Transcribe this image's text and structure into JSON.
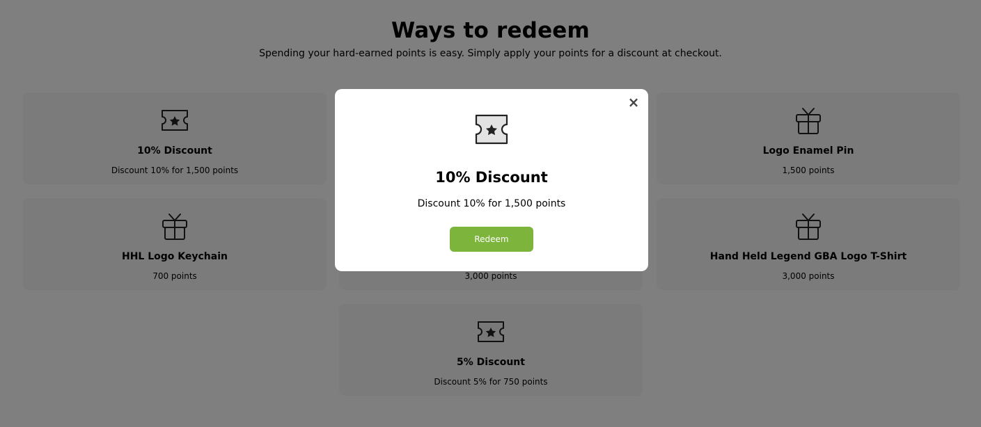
{
  "header": {
    "title": "Ways to redeem",
    "subtitle": "Spending your hard-earned points is easy. Simply apply your points for a discount at checkout."
  },
  "rewards": [
    {
      "title": "10% Discount",
      "desc": "Discount 10% for 1,500 points",
      "icon": "ticket-star-icon"
    },
    {
      "title": "",
      "desc": "",
      "icon": ""
    },
    {
      "title": "Logo Enamel Pin",
      "desc": "1,500 points",
      "icon": "gift-icon"
    },
    {
      "title": "HHL Logo Keychain",
      "desc": "700 points",
      "icon": "gift-icon"
    },
    {
      "title": "",
      "desc": "3,000 points",
      "icon": ""
    },
    {
      "title": "Hand Held Legend GBA Logo T-Shirt",
      "desc": "3,000 points",
      "icon": "gift-icon"
    },
    {
      "title": "5% Discount",
      "desc": "Discount 5% for 750 points",
      "icon": "ticket-star-icon"
    }
  ],
  "modal": {
    "close_label": "×",
    "icon": "ticket-star-icon",
    "title": "10% Discount",
    "desc": "Discount 10% for 1,500 points",
    "button_label": "Redeem"
  },
  "colors": {
    "accent": "#7db53c",
    "card_bg": "#f7f7f7",
    "overlay": "rgba(0,0,0,0.5)"
  }
}
